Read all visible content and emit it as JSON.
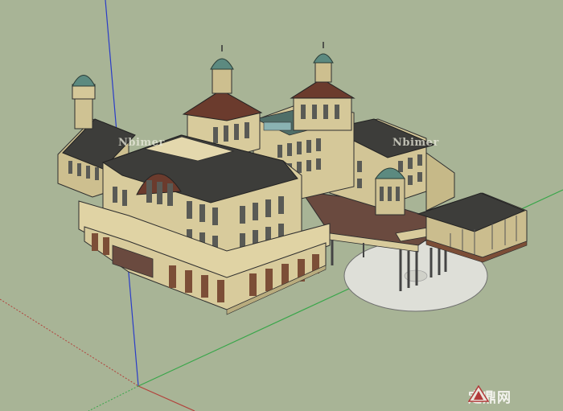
{
  "watermarks": {
    "left": "Nbimer",
    "right": "Nbimer"
  },
  "logo": {
    "text": "定鼎网",
    "icon": "logo-mark-icon"
  },
  "colors": {
    "background": "#a8b496",
    "wall": "#d8cb9c",
    "roof": "#3d3d3a",
    "dome": "#5c8a80",
    "axis_red": "#b2423c",
    "axis_green": "#39a64a",
    "axis_blue": "#2a3cc8"
  }
}
